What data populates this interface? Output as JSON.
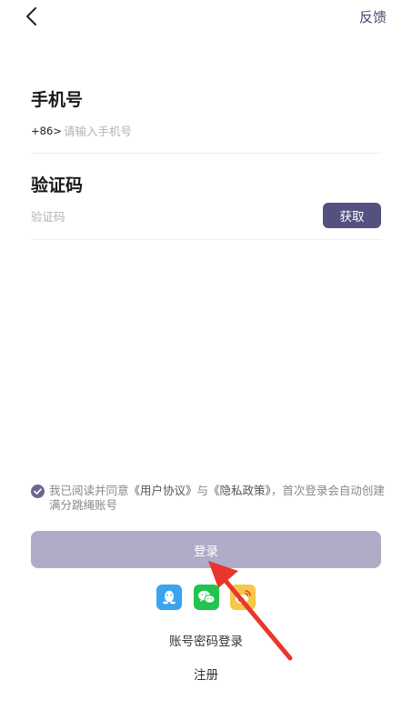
{
  "header": {
    "feedback_label": "反馈",
    "back_icon": "chevron-left-icon"
  },
  "phone": {
    "title": "手机号",
    "prefix": "+86>",
    "placeholder": "请输入手机号"
  },
  "code": {
    "title": "验证码",
    "placeholder": "验证码",
    "get_label": "获取"
  },
  "agreement": {
    "checked": true,
    "text_before": "我已阅读并同意",
    "user_agreement": "《用户协议》",
    "and": "与",
    "privacy_policy": "《隐私政策》",
    "text_after": "，首次登录会自动创建满分跳绳账号"
  },
  "login": {
    "label": "登录"
  },
  "social": [
    {
      "name": "qq-icon"
    },
    {
      "name": "wechat-icon"
    },
    {
      "name": "weibo-icon"
    }
  ],
  "links": {
    "password_login": "账号密码登录",
    "register": "注册"
  },
  "colors": {
    "accent": "#54507f",
    "login_button": "#aeacc7",
    "arrow": "#e8362c",
    "qq": "#3aa4ef",
    "wechat": "#22c34f",
    "weibo": "#f5c74a"
  }
}
